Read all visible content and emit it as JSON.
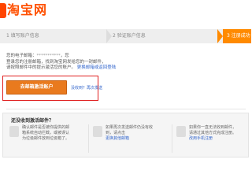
{
  "brand": {
    "logo_text": "淘宝网"
  },
  "steps": [
    {
      "label": "1 填写账户信息"
    },
    {
      "label": "2 验证账户信息"
    },
    {
      "label": "3 注册成功"
    }
  ],
  "info": {
    "line1_prefix": "您的电子邮箱：",
    "email_masked": "***********",
    "line1_suffix": "，您",
    "line2": "登录您的注册邮箱，找到淘宝网发给您的一封邮件，",
    "line3_prefix": "请按照邮件中的提示激活您的账户。",
    "line3_link": "更换邮箱或返回登陆"
  },
  "actions": {
    "primary_label": "去邮箱激活账户",
    "resend_text": "没收到？再次发送"
  },
  "help": {
    "title": "还没收到激活邮件？",
    "tips": [
      {
        "text": "确认邮件是否被你提供的邮箱系统自动拦截，或被误认为垃圾邮件放到垃圾箱了。",
        "link": ""
      },
      {
        "text": "如果再次发送邮件仍没有收到，请点击",
        "link": "更换其他邮箱"
      },
      {
        "text": "如果你一直无法收到邮件，请通过其他方式完成注册。",
        "link": "改用手机注册"
      }
    ]
  },
  "colors": {
    "brand": "#ff5000",
    "step_active": "#ff8a00",
    "primary_button": "#e97a1e",
    "highlight_border": "#e02020",
    "link": "#3366cc"
  }
}
